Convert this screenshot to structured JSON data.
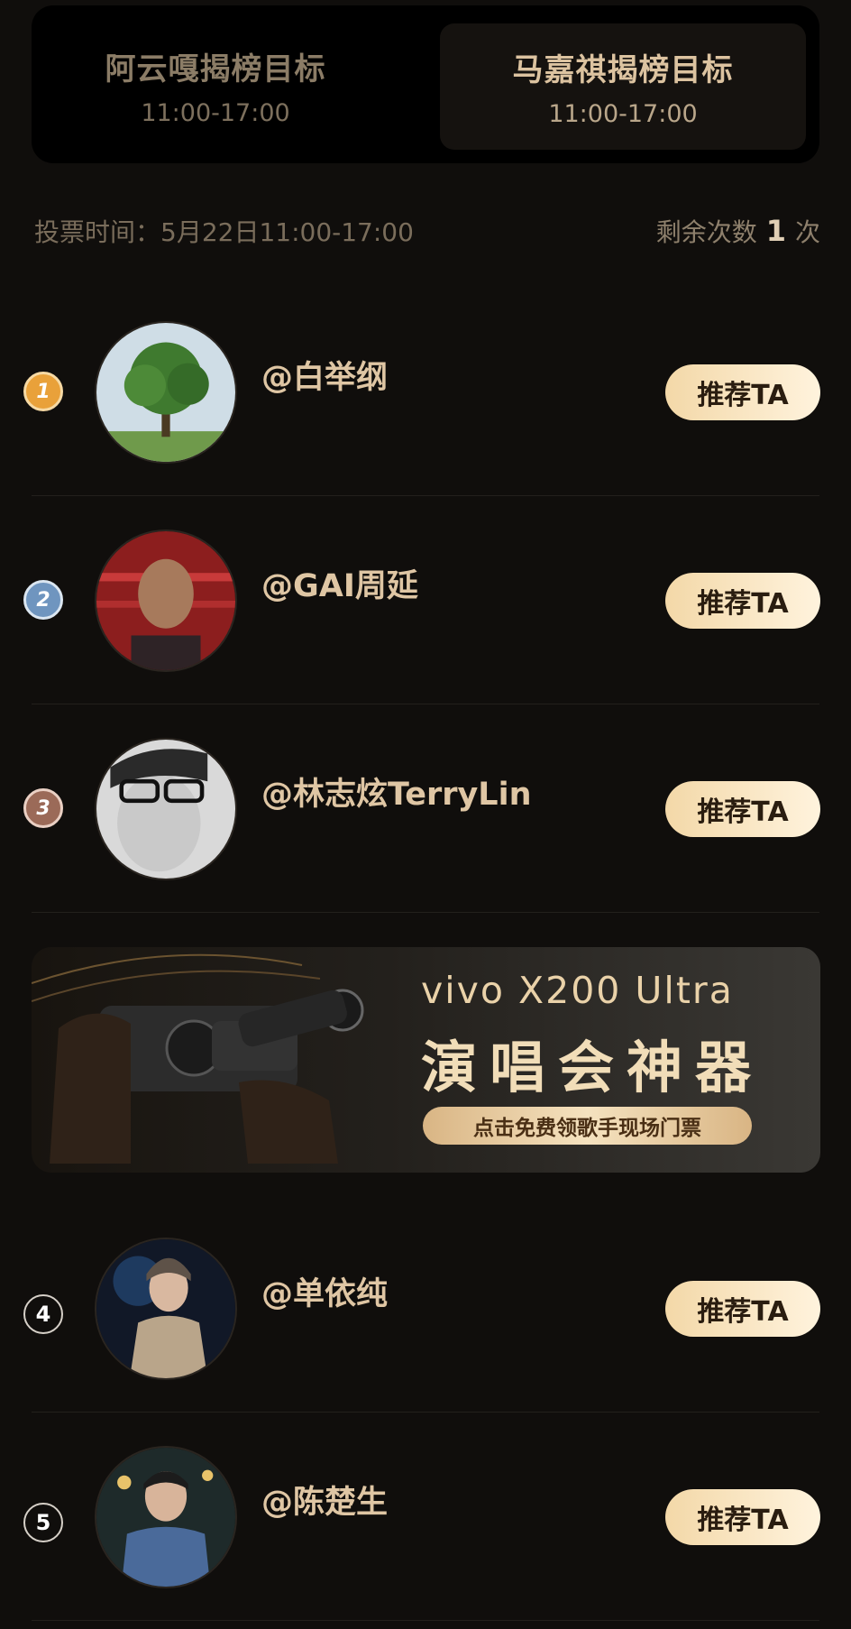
{
  "tabs": [
    {
      "title": "阿云嘎揭榜目标",
      "time": "11:00-17:00",
      "active": false
    },
    {
      "title": "马嘉祺揭榜目标",
      "time": "11:00-17:00",
      "active": true
    }
  ],
  "vote_info": {
    "time_label": "投票时间：5月22日11:00-17:00",
    "remaining_prefix": "剩余次数",
    "remaining_count": "1",
    "remaining_suffix": "次"
  },
  "candidates": [
    {
      "rank": "1",
      "name": "@白举纲",
      "button": "推荐TA"
    },
    {
      "rank": "2",
      "name": "@GAI周延",
      "button": "推荐TA"
    },
    {
      "rank": "3",
      "name": "@林志炫TerryLin",
      "button": "推荐TA"
    },
    {
      "rank": "4",
      "name": "@单依纯",
      "button": "推荐TA"
    },
    {
      "rank": "5",
      "name": "@陈楚生",
      "button": "推荐TA"
    }
  ],
  "banner": {
    "brand": "vivo X200 Ultra",
    "title": "演唱会神器",
    "cta": "点击免费领歌手现场门票"
  },
  "colors": {
    "background": "#100e0c",
    "accent_gold": "#dfc6a4",
    "button_gradient_start": "#f3d8a8",
    "button_gradient_end": "#fff3dd"
  }
}
